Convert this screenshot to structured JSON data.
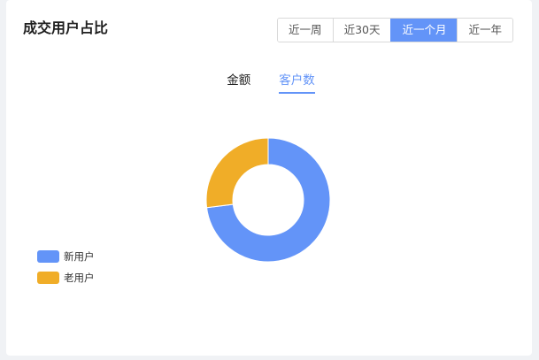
{
  "card": {
    "title": "成交用户占比"
  },
  "range_buttons": [
    {
      "label": "近一周",
      "active": false
    },
    {
      "label": "近30天",
      "active": false
    },
    {
      "label": "近一个月",
      "active": true
    },
    {
      "label": "近一年",
      "active": false
    }
  ],
  "tabs": [
    {
      "label": "金额",
      "active": false
    },
    {
      "label": "客户数",
      "active": true
    }
  ],
  "colors": {
    "accent": "#6394f8",
    "new_user": "#6394f8",
    "old_user": "#f0ad28"
  },
  "chart_data": {
    "type": "pie",
    "style": "donut",
    "legend_position": "bottom-left",
    "categories": [
      "新用户",
      "老用户"
    ],
    "values": [
      73,
      27
    ],
    "colors": [
      "#6394f8",
      "#f0ad28"
    ]
  }
}
